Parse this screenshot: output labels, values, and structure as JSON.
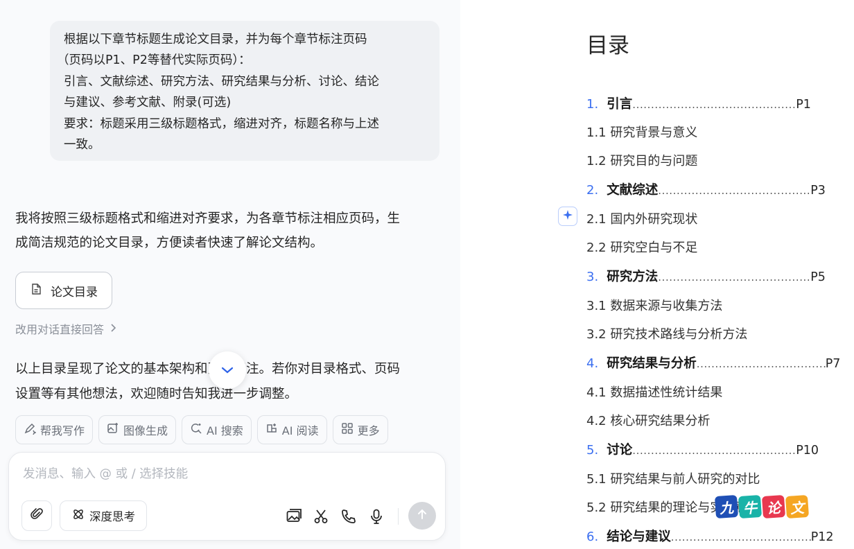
{
  "user_message": {
    "lines": [
      "根据以下章节标题生成论文目录，并为每个章节标注页码",
      "（页码以P1、P2等替代实际页码）：",
      "引言、文献综述、研究方法、研究结果与分析、讨论、结论",
      "与建议、参考文献、附录(可选)",
      "要求：标题采用三级标题格式，缩进对齐，标题名称与上述",
      "一致。"
    ]
  },
  "assistant_reply": {
    "lines": [
      "我将按照三级标题格式和缩进对齐要求，为各章节标注相应页码，生",
      "成简洁规范的论文目录，方便读者快速了解论文结构。"
    ],
    "doc_chip_label": "论文目录",
    "alt_link_label": "改用对话直接回答",
    "summary_lines": [
      "以上目录呈现了论文的基本架构和页码标注。若你对目录格式、页码",
      "设置等有其他想法，欢迎随时告知我进一步调整。"
    ]
  },
  "skills": [
    {
      "label": "帮我写作",
      "icon": "pen-sparkle-icon"
    },
    {
      "label": "图像生成",
      "icon": "image-sparkle-icon"
    },
    {
      "label": "AI 搜索",
      "icon": "search-sparkle-icon"
    },
    {
      "label": "AI 阅读",
      "icon": "read-sparkle-icon"
    },
    {
      "label": "更多",
      "icon": "grid-icon"
    }
  ],
  "composer": {
    "placeholder": "发消息、输入 @ 或 / 选择技能",
    "value": "",
    "deep_think_label": "深度思考"
  },
  "document": {
    "title": "目录",
    "entries": [
      {
        "level": 1,
        "num": "1.",
        "title": "引言",
        "page": "P1"
      },
      {
        "level": 2,
        "title": "1.1 研究背景与意义"
      },
      {
        "level": 2,
        "title": "1.2 研究目的与问题"
      },
      {
        "level": 1,
        "num": "2.",
        "title": "文献综述",
        "page": "P3"
      },
      {
        "level": 2,
        "title": "2.1 国内外研究现状"
      },
      {
        "level": 2,
        "title": "2.2 研究空白与不足"
      },
      {
        "level": 1,
        "num": "3.",
        "title": "研究方法",
        "page": "P5"
      },
      {
        "level": 2,
        "title": "3.1 数据来源与收集方法"
      },
      {
        "level": 2,
        "title": "3.2 研究技术路线与分析方法"
      },
      {
        "level": 1,
        "num": "4.",
        "title": "研究结果与分析",
        "page": "P7"
      },
      {
        "level": 2,
        "title": "4.1 数据描述性统计结果"
      },
      {
        "level": 2,
        "title": "4.2 核心研究结果分析"
      },
      {
        "level": 1,
        "num": "5.",
        "title": "讨论",
        "page": "P10"
      },
      {
        "level": 2,
        "title": "5.1 研究结果与前人研究的对比"
      },
      {
        "level": 2,
        "title": "5.2 研究结果的理论与实践意义"
      },
      {
        "level": 1,
        "num": "6.",
        "title": "结论与建议",
        "page": "P12"
      }
    ]
  },
  "watermark": {
    "chars": [
      "九",
      "牛",
      "论",
      "文"
    ],
    "colors": [
      "#1f4fb5",
      "#19b3a8",
      "#e8384f",
      "#f5a623"
    ]
  },
  "colors": {
    "accent_blue": "#3b6ff0",
    "send_disabled": "#d5d7db"
  }
}
